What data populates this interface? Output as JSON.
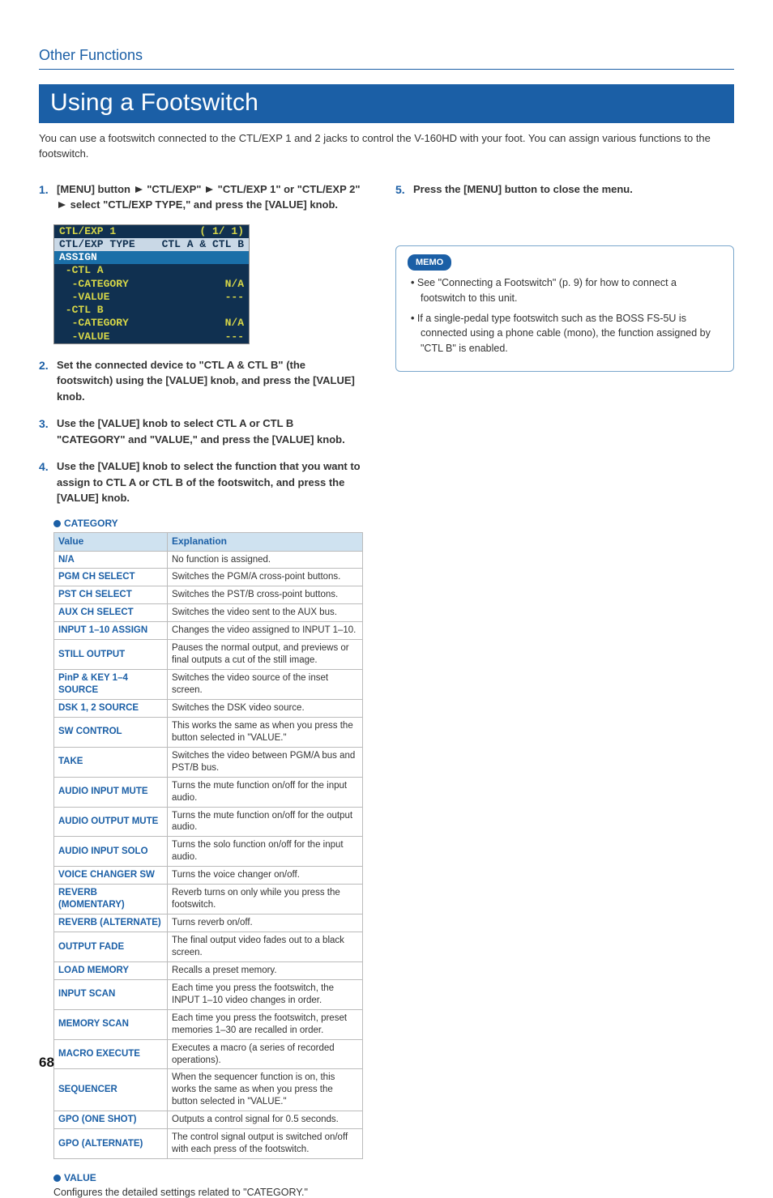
{
  "breadcrumb": "Other Functions",
  "heading": "Using a Footswitch",
  "intro": "You can use a footswitch connected to the CTL/EXP 1 and 2 jacks to control the V-160HD with your foot. You can assign various functions to the footswitch.",
  "steps": {
    "s1a": "[MENU] button ",
    "s1b": " \"CTL/EXP\" ",
    "s1c": " \"CTL/EXP 1\" or \"CTL/EXP 2\" ",
    "s1d": " select \"CTL/EXP TYPE,\" and press the [VALUE] knob.",
    "s2": "Set the connected device to \"CTL A & CTL B\" (the footswitch) using the [VALUE] knob, and press the [VALUE] knob.",
    "s3": "Use the [VALUE] knob to select CTL A or CTL B \"CATEGORY\" and \"VALUE,\" and press the [VALUE] knob.",
    "s4": "Use the [VALUE] knob to select the function that you want to assign to CTL A or CTL B of the footswitch, and press the [VALUE] knob.",
    "s5": "Press the [MENU] button to close the menu."
  },
  "menu_shot": {
    "title_l": "CTL/EXP 1",
    "title_r": "( 1/ 1)",
    "sel_l": "CTL/EXP TYPE",
    "sel_r": "CTL A & CTL B",
    "assign": "ASSIGN",
    "ctla": " -CTL A",
    "cat": "  -CATEGORY",
    "cat_r": "N/A",
    "val": "  -VALUE",
    "val_r": "---",
    "ctlb": " -CTL B",
    "catb": "  -CATEGORY",
    "catb_r": "N/A",
    "valb": "  -VALUE",
    "valb_r": "---"
  },
  "category_label": "CATEGORY",
  "table": {
    "h1": "Value",
    "h2": "Explanation",
    "rows": [
      {
        "v": "N/A",
        "e": "No function is assigned."
      },
      {
        "v": "PGM CH SELECT",
        "e": "Switches the PGM/A cross-point buttons."
      },
      {
        "v": "PST CH SELECT",
        "e": "Switches the PST/B cross-point buttons."
      },
      {
        "v": "AUX CH SELECT",
        "e": "Switches the video sent to the AUX bus."
      },
      {
        "v": "INPUT 1–10 ASSIGN",
        "e": "Changes the video assigned to INPUT 1–10."
      },
      {
        "v": "STILL OUTPUT",
        "e": "Pauses the normal output, and previews or final outputs a cut of the still image."
      },
      {
        "v": "PinP & KEY 1–4 SOURCE",
        "e": "Switches the video source of the inset screen."
      },
      {
        "v": "DSK 1, 2 SOURCE",
        "e": "Switches the DSK video source."
      },
      {
        "v": "SW CONTROL",
        "e": "This works the same as when you press the button selected in \"VALUE.\""
      },
      {
        "v": "TAKE",
        "e": "Switches the video between PGM/A bus and PST/B bus."
      },
      {
        "v": "AUDIO INPUT MUTE",
        "e": "Turns the mute function on/off for the input audio."
      },
      {
        "v": "AUDIO OUTPUT MUTE",
        "e": "Turns the mute function on/off for the output audio."
      },
      {
        "v": "AUDIO INPUT SOLO",
        "e": "Turns the solo function on/off for the input audio."
      },
      {
        "v": "VOICE CHANGER SW",
        "e": "Turns the voice changer on/off."
      },
      {
        "v": "REVERB (MOMENTARY)",
        "e": "Reverb turns on only while you press the footswitch."
      },
      {
        "v": "REVERB (ALTERNATE)",
        "e": "Turns reverb on/off."
      },
      {
        "v": "OUTPUT FADE",
        "e": "The final output video fades out to a black screen."
      },
      {
        "v": "LOAD MEMORY",
        "e": "Recalls a preset memory."
      },
      {
        "v": "INPUT SCAN",
        "e": "Each time you press the footswitch, the INPUT 1–10 video changes in order."
      },
      {
        "v": "MEMORY SCAN",
        "e": "Each time you press the footswitch, preset memories 1–30 are recalled in order."
      },
      {
        "v": "MACRO EXECUTE",
        "e": "Executes a macro (a series of recorded operations)."
      },
      {
        "v": "SEQUENCER",
        "e": "When the sequencer function is on, this works the same as when you press the button selected in \"VALUE.\""
      },
      {
        "v": "GPO (ONE SHOT)",
        "e": "Outputs a control signal for 0.5 seconds."
      },
      {
        "v": "GPO (ALTERNATE)",
        "e": "The control signal output is switched on/off with each press of the footswitch."
      }
    ]
  },
  "value_label": "VALUE",
  "value_note": "Configures the detailed settings related to \"CATEGORY.\"",
  "memo": {
    "label": "MEMO",
    "items": [
      "See \"Connecting a Footswitch\" (p. 9) for how to connect a footswitch to this unit.",
      "If a single-pedal type footswitch such as the BOSS FS-5U is connected using a phone cable (mono), the function assigned by \"CTL B\" is enabled."
    ]
  },
  "page_number": "68"
}
